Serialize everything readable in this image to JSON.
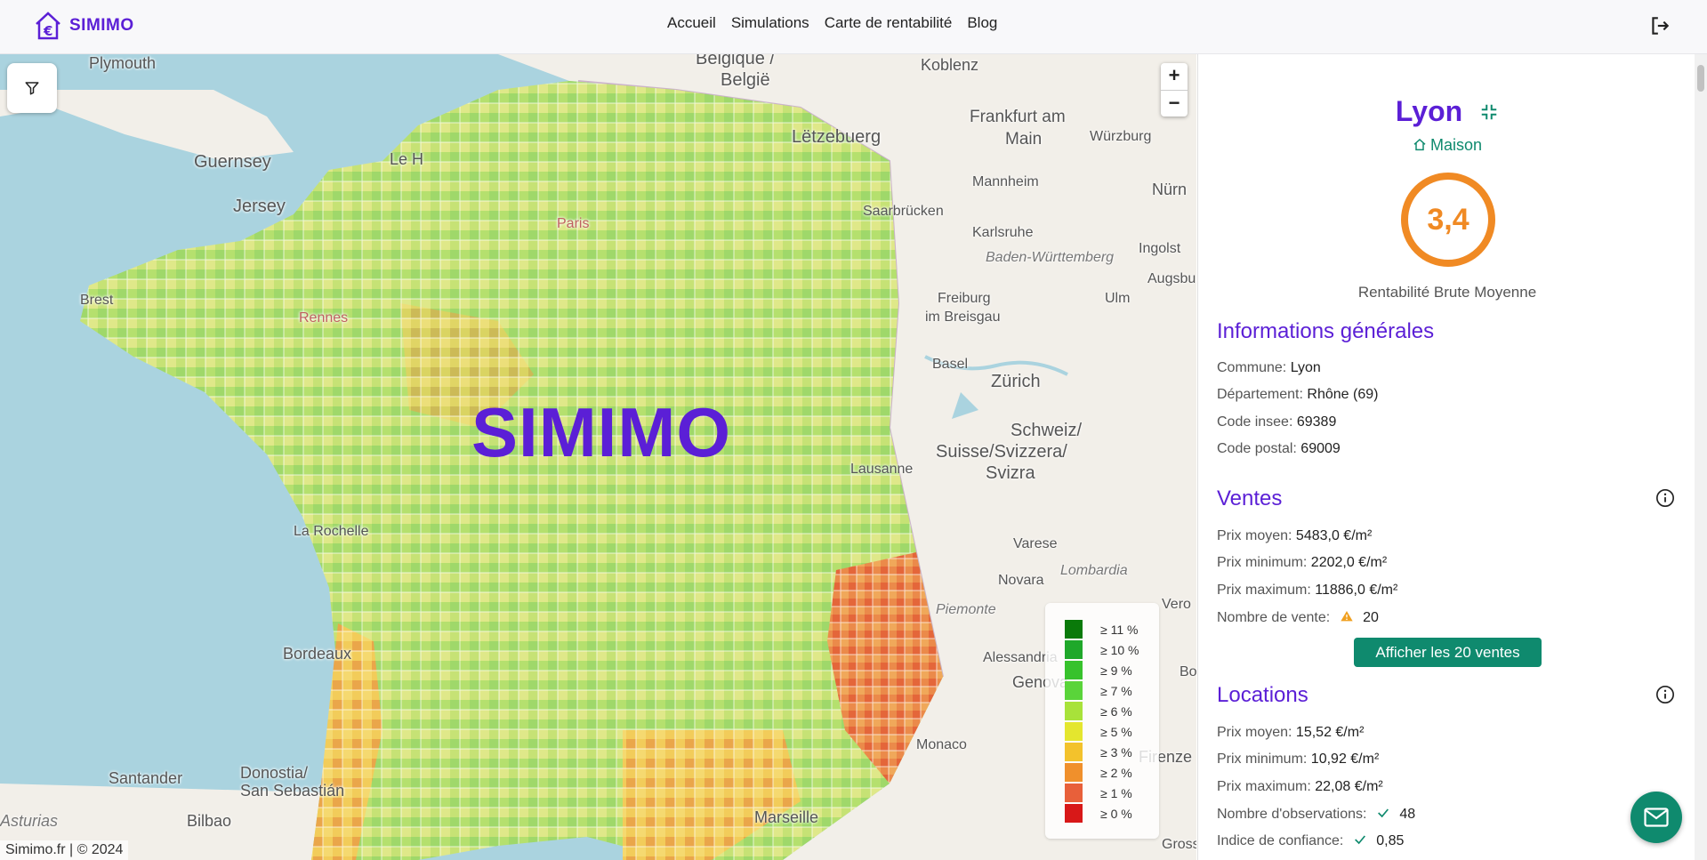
{
  "header": {
    "logo_text": "SIMIMO",
    "nav": [
      {
        "label": "Accueil"
      },
      {
        "label": "Simulations"
      },
      {
        "label": "Carte de rentabilité"
      },
      {
        "label": "Blog"
      }
    ]
  },
  "map": {
    "watermark": "SIMIMO",
    "attribution": "Simimo.fr | © 2024",
    "zoom_in": "+",
    "zoom_out": "−",
    "places": [
      {
        "label": "Plymouth"
      },
      {
        "label": "Guernsey"
      },
      {
        "label": "Jersey"
      },
      {
        "label": "Le H"
      },
      {
        "label": "Brest"
      },
      {
        "label": "Rennes"
      },
      {
        "label": "Paris"
      },
      {
        "label": "La Rochelle"
      },
      {
        "label": "Bordeaux"
      },
      {
        "label": "Santander"
      },
      {
        "label": "Bilbao"
      },
      {
        "label": "Donostia/"
      },
      {
        "label": "San Sebastián"
      },
      {
        "label": "Asturias"
      },
      {
        "label": "Belgique /"
      },
      {
        "label": "België"
      },
      {
        "label": "Lëtzebuerg"
      },
      {
        "label": "Koblenz"
      },
      {
        "label": "Frankfurt am"
      },
      {
        "label": "Main"
      },
      {
        "label": "Würzburg"
      },
      {
        "label": "Nürn"
      },
      {
        "label": "Mannheim"
      },
      {
        "label": "Saarbrücken"
      },
      {
        "label": "Karlsruhe"
      },
      {
        "label": "Baden-Württemberg"
      },
      {
        "label": "Ingolst"
      },
      {
        "label": "Augsbu"
      },
      {
        "label": "Freiburg"
      },
      {
        "label": "im Breisgau"
      },
      {
        "label": "Ulm"
      },
      {
        "label": "Basel"
      },
      {
        "label": "Zürich"
      },
      {
        "label": "Schweiz/"
      },
      {
        "label": "Suisse/Svizzera/"
      },
      {
        "label": "Svizra"
      },
      {
        "label": "Lausanne"
      },
      {
        "label": "Varese"
      },
      {
        "label": "Lombardia"
      },
      {
        "label": "Novara"
      },
      {
        "label": "Piemonte"
      },
      {
        "label": "Alessandria"
      },
      {
        "label": "Genova"
      },
      {
        "label": "Firenze"
      },
      {
        "label": "Monaco"
      },
      {
        "label": "Marseille"
      },
      {
        "label": "Vero"
      },
      {
        "label": "Grosseto"
      },
      {
        "label": "Bo"
      }
    ],
    "legend": [
      {
        "label": "≥ 11 %",
        "color": "#0a7a0a"
      },
      {
        "label": "≥ 10 %",
        "color": "#1fa82a"
      },
      {
        "label": "≥ 9 %",
        "color": "#37c22c"
      },
      {
        "label": "≥ 7 %",
        "color": "#5ad43a"
      },
      {
        "label": "≥ 6 %",
        "color": "#a8e23a"
      },
      {
        "label": "≥ 5 %",
        "color": "#e4e62e"
      },
      {
        "label": "≥ 3 %",
        "color": "#f3c22c"
      },
      {
        "label": "≥ 2 %",
        "color": "#f0902c"
      },
      {
        "label": "≥ 1 %",
        "color": "#e8603a"
      },
      {
        "label": "≥ 0 %",
        "color": "#d81818"
      }
    ]
  },
  "panel": {
    "city": "Lyon",
    "type": "Maison",
    "score": "3,4",
    "score_caption": "Rentabilité Brute Moyenne",
    "general": {
      "title": "Informations générales",
      "rows": [
        {
          "label": "Commune:",
          "value": "Lyon"
        },
        {
          "label": "Département:",
          "value": "Rhône (69)"
        },
        {
          "label": "Code insee:",
          "value": "69389"
        },
        {
          "label": "Code postal:",
          "value": "69009"
        }
      ]
    },
    "ventes": {
      "title": "Ventes",
      "rows": [
        {
          "label": "Prix moyen:",
          "value": "5483,0 €/m²"
        },
        {
          "label": "Prix minimum:",
          "value": "2202,0 €/m²"
        },
        {
          "label": "Prix maximum:",
          "value": "11886,0 €/m²"
        },
        {
          "label": "Nombre de vente:",
          "value": "20"
        }
      ],
      "button": "Afficher les 20 ventes"
    },
    "locations": {
      "title": "Locations",
      "rows": [
        {
          "label": "Prix moyen:",
          "value": "15,52 €/m²"
        },
        {
          "label": "Prix minimum:",
          "value": "10,92 €/m²"
        },
        {
          "label": "Prix maximum:",
          "value": "22,08 €/m²"
        },
        {
          "label": "Nombre d'observations:",
          "value": "48"
        },
        {
          "label": "Indice de confiance:",
          "value": "0,85"
        }
      ]
    }
  }
}
